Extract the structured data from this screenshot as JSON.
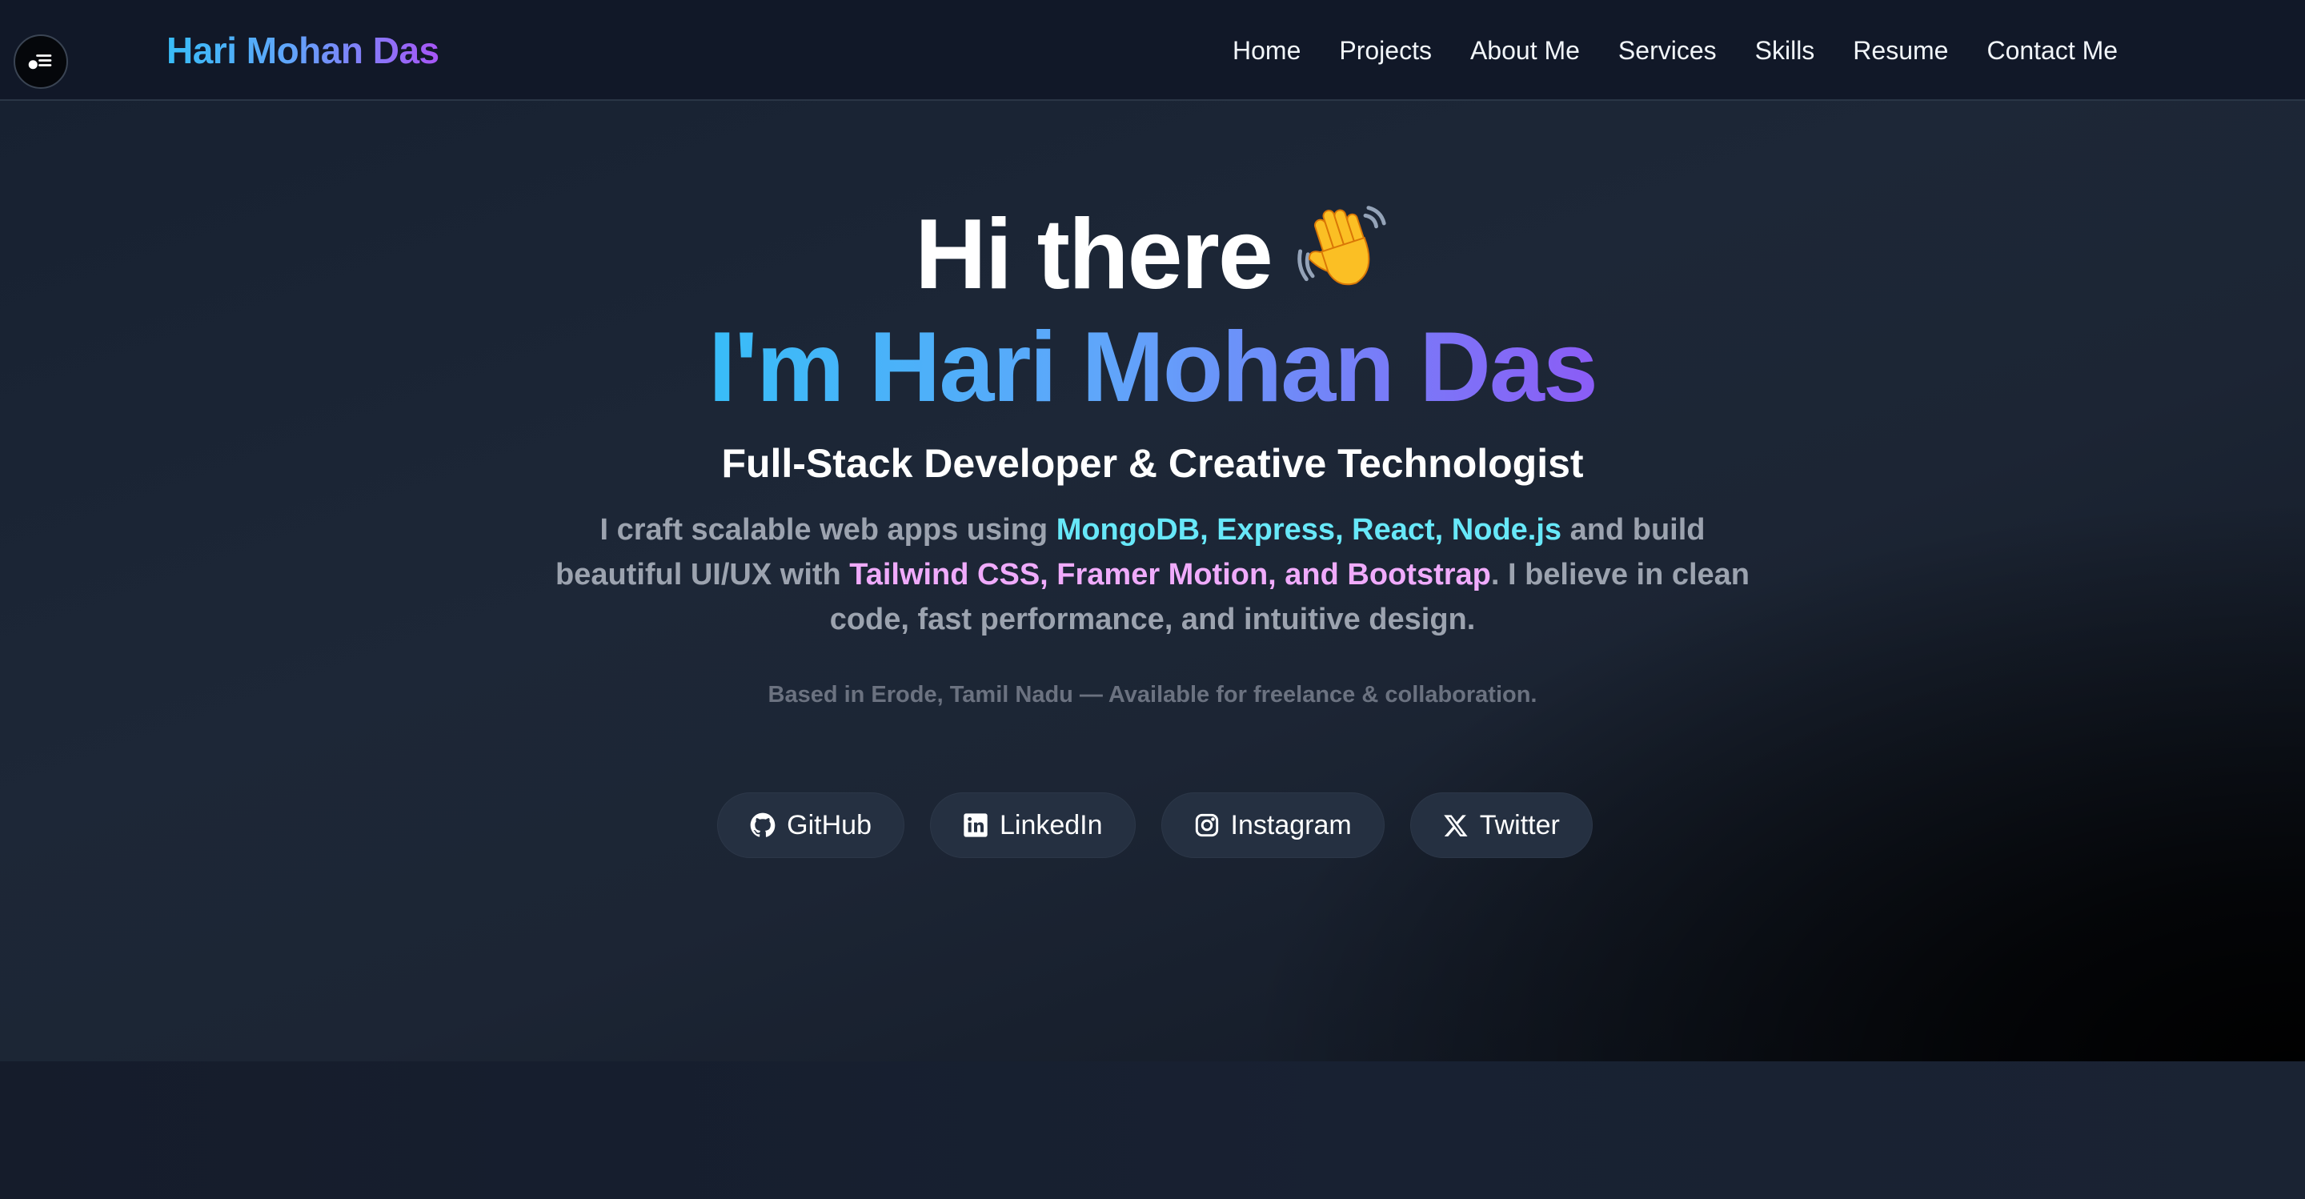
{
  "navbar": {
    "brand": "Hari Mohan Das",
    "menu_toggle_icon": "menu-toggle-icon",
    "links": [
      {
        "label": "Home"
      },
      {
        "label": "Projects"
      },
      {
        "label": "About Me"
      },
      {
        "label": "Services"
      },
      {
        "label": "Skills"
      },
      {
        "label": "Resume"
      },
      {
        "label": "Contact Me"
      }
    ]
  },
  "hero": {
    "greeting": "Hi there",
    "greeting_emoji": "waving-hand-icon",
    "name_line": "I'm Hari Mohan Das",
    "subtitle": "Full-Stack Developer & Creative Technologist",
    "description": {
      "part1": "I craft scalable web apps using ",
      "stack_highlight": "MongoDB, Express, React, Node.js",
      "part2": " and build beautiful UI/UX with ",
      "ui_highlight": "Tailwind CSS, Framer Motion, and Bootstrap",
      "part3": ". I believe in clean code, fast performance, and intuitive design."
    },
    "location": "Based in Erode, Tamil Nadu — Available for freelance & collaboration."
  },
  "socials": [
    {
      "label": "GitHub",
      "icon": "github-icon"
    },
    {
      "label": "LinkedIn",
      "icon": "linkedin-icon"
    },
    {
      "label": "Instagram",
      "icon": "instagram-icon"
    },
    {
      "label": "Twitter",
      "icon": "x-twitter-icon"
    }
  ],
  "colors": {
    "brand_gradient_start": "#38bdf8",
    "brand_gradient_end": "#a855f7",
    "stack_highlight": "#67e8f9",
    "ui_highlight": "#f0abfc",
    "body_text": "#9ca3af",
    "nav_background": "#111828"
  }
}
